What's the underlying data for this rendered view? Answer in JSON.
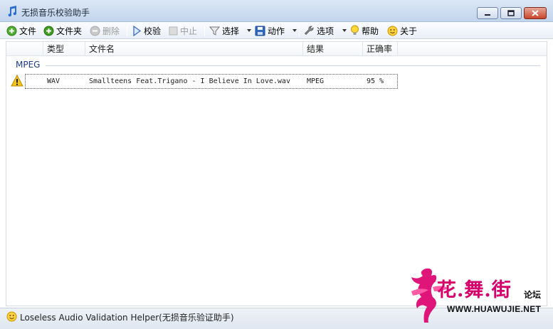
{
  "window": {
    "title": "无损音乐校验助手",
    "icon": "music-note-icon"
  },
  "toolbar": {
    "file": "文件",
    "folder": "文件夹",
    "delete": "删除",
    "verify": "校验",
    "stop": "中止",
    "select": "选择",
    "action": "动作",
    "options": "选项",
    "help": "帮助",
    "about": "关于"
  },
  "list": {
    "columns": [
      "类型",
      "文件名",
      "结果",
      "正确率"
    ],
    "group": "MPEG",
    "rows": [
      {
        "status_icon": "warning-icon",
        "type": "WAV",
        "filename": "Smallteens Feat.Trigano - I Believe In Love.wav",
        "result": "MPEG",
        "accuracy": "95 %"
      }
    ]
  },
  "statusbar": {
    "text": "Loseless Audio Validation Helper(无损音乐验证助手)"
  },
  "watermark": {
    "chinese": "花.舞.街",
    "forum": "论坛",
    "url": "WWW.HUAWUJIE.NET"
  },
  "colors": {
    "titlebar": "#c3d5ec",
    "group_label": "#1e3b8a",
    "watermark": "#d6006b"
  }
}
